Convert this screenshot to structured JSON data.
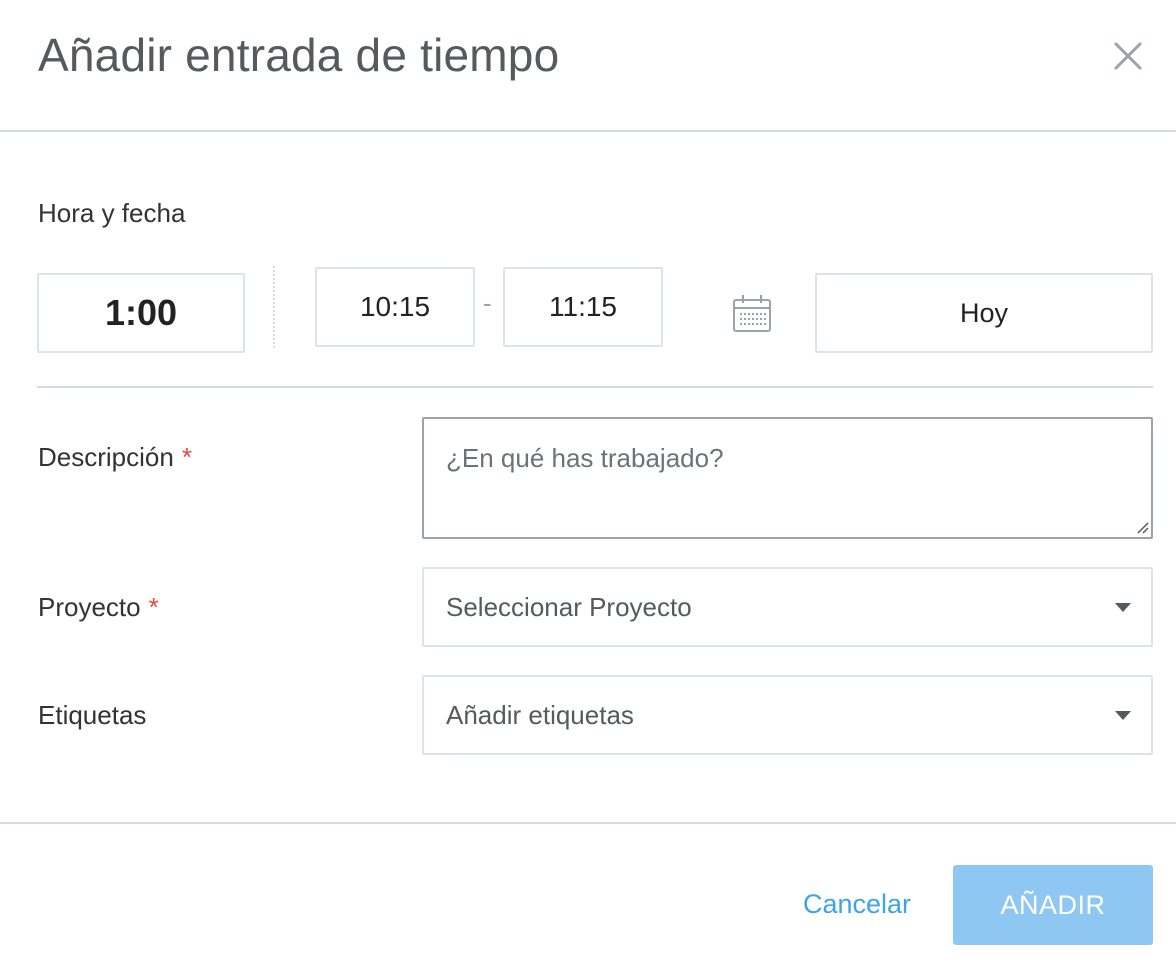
{
  "dialog": {
    "title": "Añadir entrada de tiempo",
    "close_icon": "close-icon"
  },
  "time_section": {
    "label": "Hora y fecha",
    "duration": "1:00",
    "start_time": "10:15",
    "separator": "-",
    "end_time": "11:15",
    "calendar_icon": "calendar-icon",
    "date": "Hoy"
  },
  "form": {
    "description": {
      "label": "Descripción",
      "required_mark": "*",
      "placeholder": "¿En qué has trabajado?",
      "value": ""
    },
    "project": {
      "label": "Proyecto",
      "required_mark": "*",
      "selected": "Seleccionar Proyecto"
    },
    "tags": {
      "label": "Etiquetas",
      "selected": "Añadir etiquetas"
    }
  },
  "footer": {
    "cancel_label": "Cancelar",
    "add_label": "AÑADIR"
  },
  "colors": {
    "accent": "#3da4e8",
    "add_button_disabled": "#8ec8f2",
    "required": "#e24b3b",
    "border": "#dde3e8"
  }
}
